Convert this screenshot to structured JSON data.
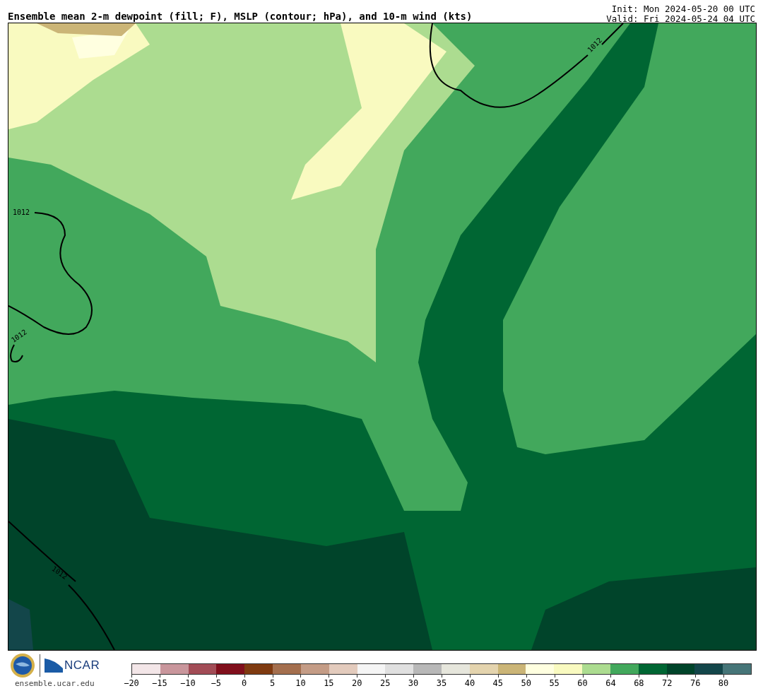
{
  "title": "Ensemble mean 2-m dewpoint (fill; F), MSLP (contour; hPa), and 10-m wind (kts)",
  "init": "Init: Mon 2024-05-20 00 UTC",
  "valid": "Valid: Fri 2024-05-24 04 UTC",
  "map": {
    "contour_labels": [
      "1012",
      "1012",
      "1012",
      "1012"
    ]
  },
  "logos": {
    "ncar": "NCAR",
    "url": "ensemble.ucar.edu"
  },
  "colorbar": {
    "segments": [
      {
        "color": "#f3e6e8"
      },
      {
        "color": "#c9969c"
      },
      {
        "color": "#a24c56"
      },
      {
        "color": "#800f1c"
      },
      {
        "color": "#7f3a10"
      },
      {
        "color": "#a46f4e"
      },
      {
        "color": "#c49c86"
      },
      {
        "color": "#e3cbbd"
      },
      {
        "color": "#f5f5f5"
      },
      {
        "color": "#e0e0e0"
      },
      {
        "color": "#b8b8b8"
      },
      {
        "color": "#e6e6dc"
      },
      {
        "color": "#e4d4ae"
      },
      {
        "color": "#cbb577"
      },
      {
        "color": "#ffffe0"
      },
      {
        "color": "#f9fac0"
      },
      {
        "color": "#acdc90"
      },
      {
        "color": "#42a85c"
      },
      {
        "color": "#006633"
      },
      {
        "color": "#00442a"
      },
      {
        "color": "#13464a"
      },
      {
        "color": "#467578"
      }
    ],
    "ticks": [
      "−20",
      "−15",
      "−10",
      "−5",
      "0",
      "5",
      "10",
      "15",
      "20",
      "25",
      "30",
      "35",
      "40",
      "45",
      "50",
      "55",
      "60",
      "64",
      "68",
      "72",
      "76",
      "80"
    ]
  }
}
